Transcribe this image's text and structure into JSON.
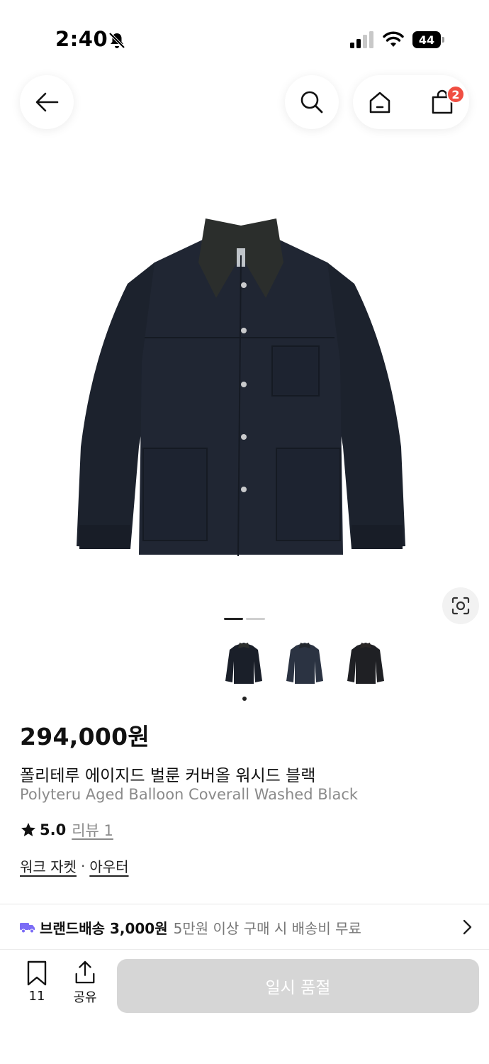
{
  "status_bar": {
    "time": "2:40",
    "battery": "44",
    "icons": [
      "mute-bell-icon",
      "cellular-signal-icon",
      "wifi-icon",
      "battery-icon"
    ]
  },
  "nav": {
    "back_icon": "arrow-left-icon",
    "search_icon": "search-icon",
    "home_icon": "home-icon",
    "cart_icon": "shopping-bag-icon",
    "cart_badge": "2",
    "badge_color": "#f04e42"
  },
  "gallery": {
    "image": "product-photo-black-coverall-jacket",
    "lens_icon": "image-search-lens-icon",
    "page_count": 2,
    "active_page": 1,
    "thumbnails": [
      "thumbnail-black",
      "thumbnail-navy",
      "thumbnail-dark"
    ],
    "selected_thumbnail": 1
  },
  "product": {
    "price": "294,000원",
    "name_ko": "폴리테루 에이지드 벌룬 커버올 워시드 블랙",
    "name_en": "Polyteru Aged Balloon Coverall Washed Black",
    "rating": "5.0",
    "review_label": "리뷰 1",
    "categories": [
      "워크 자켓",
      "아우터"
    ],
    "category_separator": "·"
  },
  "shipping": {
    "main": "브랜드배송 3,000원",
    "sub": "5만원 이상 구매 시 배송비 무료",
    "icon_color": "#7b6cf6"
  },
  "bottom_bar": {
    "bookmark_count": "11",
    "share_label": "공유",
    "soldout_label": "일시 품절"
  }
}
